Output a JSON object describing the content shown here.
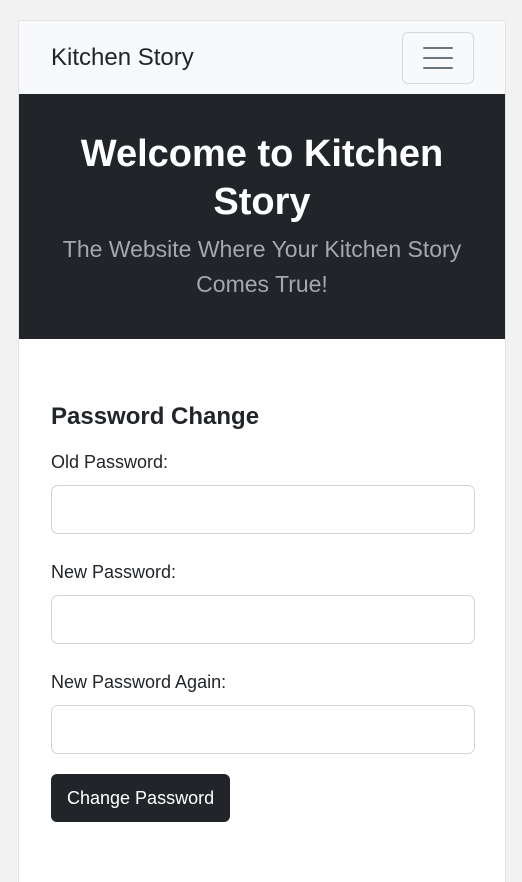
{
  "navbar": {
    "brand": "Kitchen Story",
    "toggler_icon": "hamburger-menu-icon"
  },
  "hero": {
    "title": "Welcome to Kitchen Story",
    "subtitle": "The Website Where Your Kitchen Story Comes True!"
  },
  "form": {
    "title": "Password Change",
    "fields": [
      {
        "label": "Old Password:",
        "value": "",
        "placeholder": ""
      },
      {
        "label": "New Password:",
        "value": "",
        "placeholder": ""
      },
      {
        "label": "New Password Again:",
        "value": "",
        "placeholder": ""
      }
    ],
    "submit_label": "Change Password"
  },
  "colors": {
    "navbar_bg": "#f8f9fa",
    "hero_bg": "#212529",
    "hero_title": "#ffffff",
    "hero_subtitle": "#a3a8ad",
    "button_bg": "#212529",
    "button_text": "#ffffff"
  }
}
